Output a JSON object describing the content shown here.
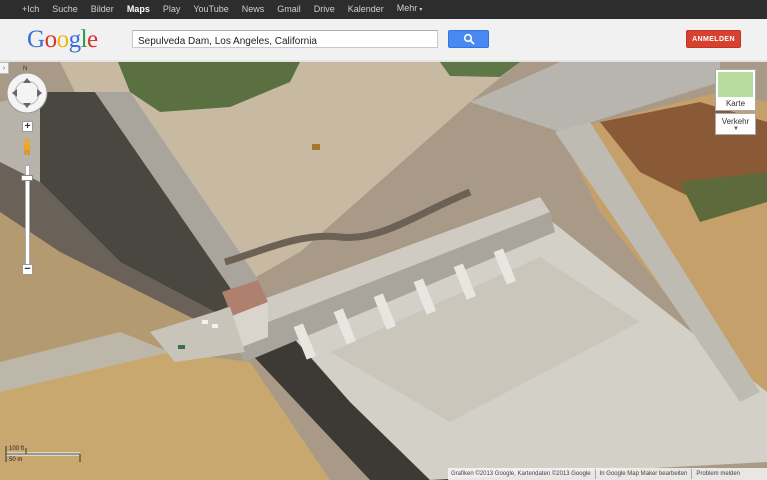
{
  "gbar": {
    "items": [
      {
        "label": "+Ich"
      },
      {
        "label": "Suche"
      },
      {
        "label": "Bilder"
      },
      {
        "label": "Maps",
        "active": true
      },
      {
        "label": "Play"
      },
      {
        "label": "YouTube"
      },
      {
        "label": "News"
      },
      {
        "label": "Gmail"
      },
      {
        "label": "Drive"
      },
      {
        "label": "Kalender"
      },
      {
        "label": "Mehr"
      }
    ]
  },
  "header": {
    "logo_letters": [
      "G",
      "o",
      "o",
      "g",
      "l",
      "e"
    ],
    "logo_colors": [
      "#3b6fd8",
      "#d6352b",
      "#f2b50f",
      "#3b6fd8",
      "#2d9a46",
      "#d6352b"
    ],
    "search_value": "Sepulveda Dam, Los Angeles, California",
    "search_icon": "search-icon",
    "signin_label": "ANMELDEN"
  },
  "map_controls": {
    "compass_label": "N",
    "zoom_in": "+",
    "zoom_out": "−",
    "map_type_label": "Karte",
    "layers_label": "Verkehr",
    "scale_top": "100 ft",
    "scale_bottom": "50 m"
  },
  "footer": {
    "attribution": "Grafiken ©2013 Google, Kartendaten ©2013 Google",
    "mapmaker": "In Google Map Maker bearbeiten",
    "report": "Problem melden"
  },
  "colors": {
    "gbar_bg": "#2d2d2d",
    "search_button": "#4888f0",
    "signin_button": "#d8412f"
  }
}
